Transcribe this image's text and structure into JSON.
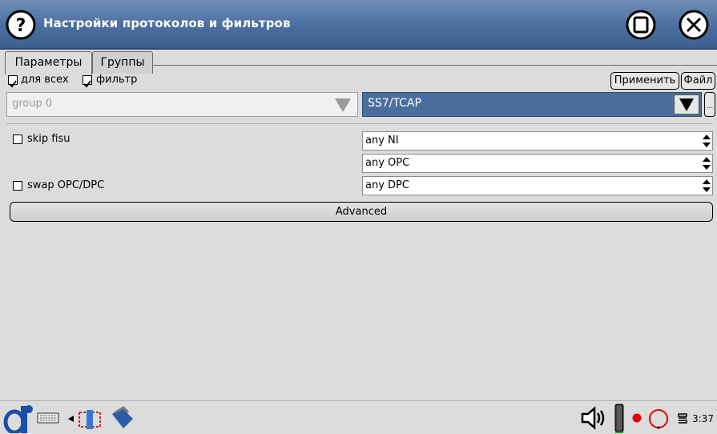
{
  "window": {
    "title": "Настройки протоколов и фильтров",
    "help_icon": "question-circle-icon",
    "stop_icon": "stop-square-icon",
    "close_icon": "close-circle-icon",
    "titlebar_color": "#4a6e9e"
  },
  "tabs": [
    {
      "label": "Параметры",
      "active": true
    },
    {
      "label": "Группы",
      "active": false
    }
  ],
  "options": {
    "for_all": {
      "label": "для всех",
      "checked": true
    },
    "filter": {
      "label": "фильтр",
      "checked": true
    }
  },
  "actions": {
    "apply": "Применить",
    "file": "Файл",
    "more": "..."
  },
  "group_select": {
    "value": "group 0",
    "disabled": true
  },
  "protocol_select": {
    "value": "SS7/TCAP",
    "color": "#4a6e9e"
  },
  "skip_fisu": {
    "label": "skip fisu",
    "checked": false
  },
  "swap_opc_dpc": {
    "label": "swap OPC/DPC",
    "checked": false
  },
  "ni_field": {
    "value": "any NI"
  },
  "opc_field": {
    "value": "any OPC"
  },
  "dpc_field": {
    "value": "any DPC"
  },
  "advanced_button": "Advanced",
  "taskbar": {
    "clock": "3:37",
    "icons": [
      "start-icon",
      "keyboard-icon",
      "arrow-left-icon",
      "network-icon",
      "phone-icon",
      "speaker-icon",
      "battery-icon",
      "record-dot-icon",
      "circle-icon",
      "menu-icon"
    ]
  }
}
